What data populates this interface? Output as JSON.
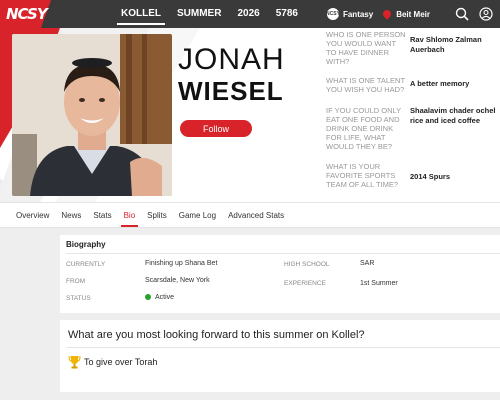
{
  "brand": {
    "logo_text": "NCSY",
    "accent": "#d8232a"
  },
  "topnav": {
    "tabs": [
      "KOLLEL",
      "SUMMER",
      "2026",
      "5786"
    ],
    "active_tab": "KOLLEL",
    "fantasy_badge": "NCSY",
    "fantasy_label": "Fantasy",
    "location_label": "Beit Meir",
    "icons": [
      "search-icon",
      "account-icon"
    ]
  },
  "player": {
    "first_name": "JONAH",
    "last_name": "WIESEL",
    "follow_label": "Follow"
  },
  "qa": [
    {
      "question": "WHO IS ONE PERSON YOU WOULD WANT TO HAVE DINNER WITH?",
      "answer": "Rav Shlomo Zalman Auerbach"
    },
    {
      "question": "WHAT IS ONE TALENT YOU WISH YOU HAD?",
      "answer": "A better memory"
    },
    {
      "question": "IF YOU COULD ONLY EAT ONE FOOD AND DRINK ONE DRINK FOR LIFE, WHAT WOULD THEY BE?",
      "answer": "Shaalavim chader ochel rice and iced coffee"
    },
    {
      "question": "WHAT IS YOUR FAVORITE SPORTS TEAM OF ALL TIME?",
      "answer": "2014 Spurs"
    }
  ],
  "subnav": {
    "items": [
      "Overview",
      "News",
      "Stats",
      "Bio",
      "Splits",
      "Game Log",
      "Advanced Stats"
    ],
    "active": "Bio"
  },
  "biography": {
    "title": "Biography",
    "currently_label": "CURRENTLY",
    "currently_value": "Finishing up Shana Bet",
    "from_label": "FROM",
    "from_value": "Scarsdale, New York",
    "status_label": "STATUS",
    "status_value": "Active",
    "status_color": "#2ca02c",
    "high_school_label": "HIGH SCHOOL",
    "high_school_value": "SAR",
    "experience_label": "EXPERIENCE",
    "experience_value": "1st Summer"
  },
  "question_card": {
    "question": "What are you most looking forward to this summer on Kollel?",
    "answer": "To give over Torah",
    "icon": "trophy-icon"
  }
}
